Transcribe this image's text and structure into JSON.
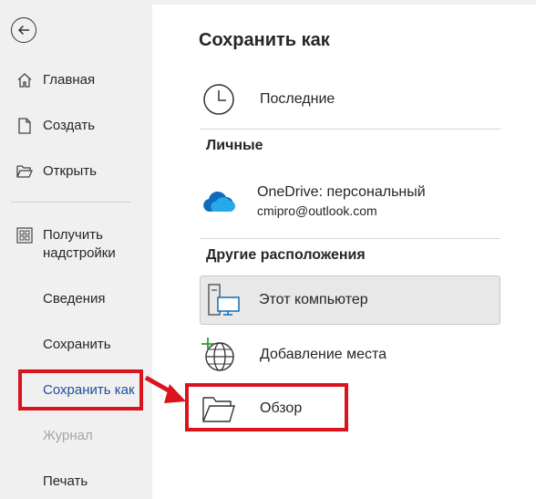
{
  "sidebar": {
    "items": [
      {
        "label": "Главная",
        "icon": "home-icon"
      },
      {
        "label": "Создать",
        "icon": "new-document-icon"
      },
      {
        "label": "Открыть",
        "icon": "open-folder-icon"
      },
      {
        "label": "Получить надстройки",
        "line1": "Получить",
        "line2": "надстройки",
        "icon": "addins-grid-icon"
      },
      {
        "label": "Сведения"
      },
      {
        "label": "Сохранить"
      },
      {
        "label": "Сохранить как",
        "active": true
      },
      {
        "label": "Журнал",
        "disabled": true
      },
      {
        "label": "Печать"
      }
    ],
    "active_color": "#1f4e9e",
    "disabled_color": "#a6a6a6"
  },
  "main": {
    "title": "Сохранить как",
    "recent": {
      "label": "Последние",
      "icon": "clock-icon"
    },
    "personal_heading": "Личные",
    "onedrive": {
      "label": "OneDrive: персональный",
      "account": "cmipro@outlook.com",
      "icon": "onedrive-cloud-icon"
    },
    "other_heading": "Другие расположения",
    "this_pc": {
      "label": "Этот компьютер",
      "icon": "computer-icon",
      "selected": true
    },
    "add_place": {
      "label": "Добавление места",
      "icon": "globe-add-icon"
    },
    "browse": {
      "label": "Обзор",
      "icon": "folder-icon"
    }
  },
  "highlight_color": "#d9141c"
}
